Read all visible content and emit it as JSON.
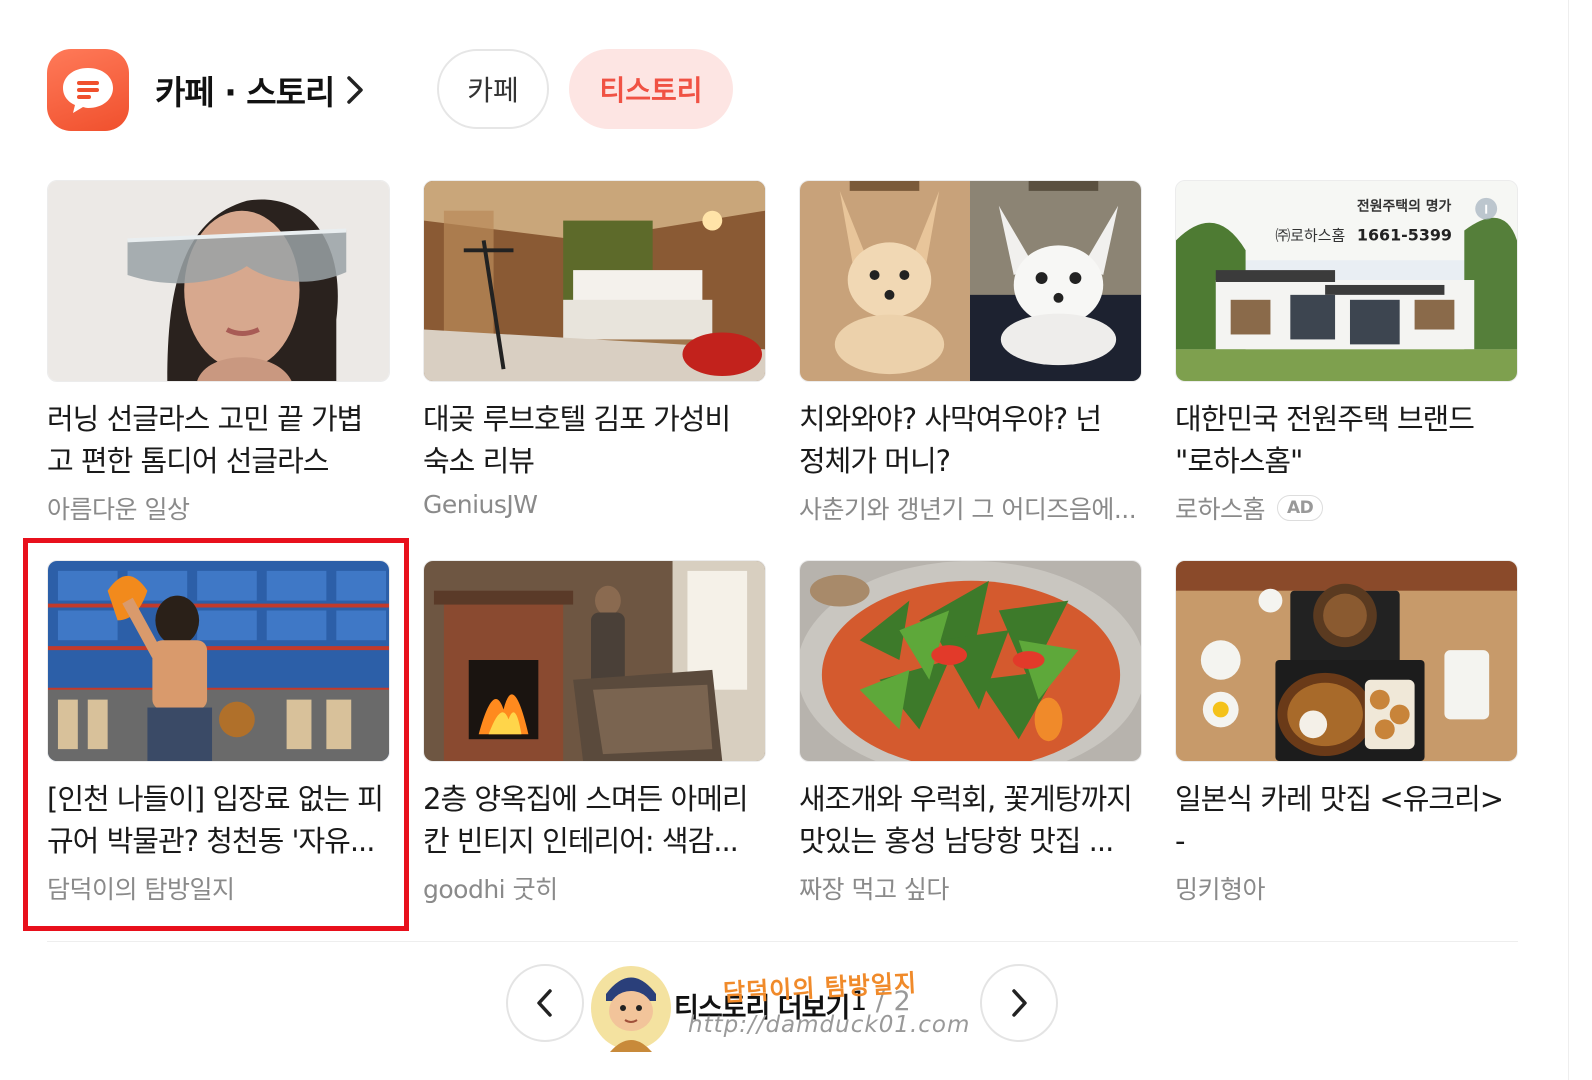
{
  "header": {
    "title": "카페 · 스토리",
    "tabs": [
      {
        "label": "카페",
        "active": false
      },
      {
        "label": "티스토리",
        "active": true
      }
    ]
  },
  "colors": {
    "accent": "#f05244",
    "accent_bg": "#fde5e3",
    "icon_gradient_start": "#ff7a59",
    "icon_gradient_end": "#f0502d",
    "highlight_border": "#e8101c"
  },
  "cards": [
    {
      "title": "러닝 선글라스 고민 끝 가볍\n고 편한 톰디어 선글라스",
      "source": "아름다운 일상",
      "ad": false,
      "image": "woman-sunglasses"
    },
    {
      "title": "대곶 루브호텔 김포 가성비\n숙소 리뷰",
      "source": "GeniusJW",
      "ad": false,
      "image": "hotel-room"
    },
    {
      "title": "치와와야? 사막여우야? 넌\n정체가 머니?",
      "source": "사춘기와 갱년기 그 어디즈음에...",
      "ad": false,
      "image": "fox-and-chihuahua"
    },
    {
      "title": "대한민국 전원주택 브랜드\n\"로하스홈\"",
      "source": "로하스홈",
      "ad": true,
      "ad_label": "AD",
      "image": "house-ad",
      "image_text": {
        "brand": "㈜로하스홈",
        "slogan": "전원주택의 명가",
        "phone": "1661-5399"
      }
    },
    {
      "title": "[인천 나들이] 입장료 없는 피\n규어 박물관? 청천동 '자유...",
      "source": "담덕이의 탐방일지",
      "ad": false,
      "image": "figure-museum",
      "highlighted": true
    },
    {
      "title": "2층 양옥집에 스며든 아메리\n칸 빈티지 인테리어: 색감...",
      "source": "goodhi 굿히",
      "ad": false,
      "image": "fireplace-room"
    },
    {
      "title": "새조개와 우럭회, 꽃게탕까지\n맛있는 홍성 남당항 맛집 ...",
      "source": "짜장 먹고 싶다",
      "ad": false,
      "image": "seafood-salad"
    },
    {
      "title": "일본식 카레 맛집 <유크리> -\n수제 레몬 소바, 등심카츠, ...",
      "source": "밍키형아",
      "ad": false,
      "image": "curry-table"
    }
  ],
  "pagination": {
    "more_label": "티스토리 더보기",
    "current": "1",
    "total": "2",
    "prev_icon": "chevron-left-icon",
    "next_icon": "chevron-right-icon"
  },
  "watermark": {
    "name": "담덕이의 탐방일지",
    "url": "http://damduck01.com"
  }
}
